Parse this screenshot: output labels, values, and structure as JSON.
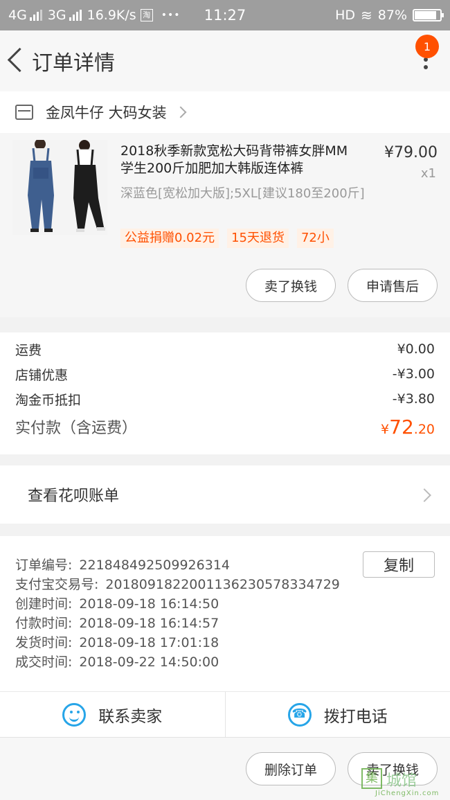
{
  "status_bar": {
    "net1": "4G",
    "net2": "3G",
    "speed": "16.9K/s",
    "app_icon_text": "淘",
    "dots": "•••",
    "time": "11:27",
    "hd": "HD",
    "wifi_glyph": "≋",
    "battery": "87%",
    "battery_level": 0.87
  },
  "navbar": {
    "title": "订单详情",
    "badge": "1"
  },
  "shop": {
    "name": "金凤牛仔 大码女装"
  },
  "product": {
    "title": "2018秋季新款宽松大码背带裤女胖MM学生200斤加肥加大韩版连体裤",
    "price": "¥79.00",
    "qty": "x1",
    "sku": "深蓝色[宽松加大版];5XL[建议180至200斤]",
    "tags": [
      "公益捐赠0.02元",
      "15天退货",
      "72小"
    ],
    "btn_sell": "卖了换钱",
    "btn_after_sale": "申请售后"
  },
  "fees": {
    "rows": [
      {
        "label": "运费",
        "value": "¥0.00"
      },
      {
        "label": "店铺优惠",
        "value": "-¥3.00"
      },
      {
        "label": "淘金币抵扣",
        "value": "-¥3.80"
      }
    ],
    "total_label": "实付款（含运费）",
    "total_currency": "¥",
    "total_int": "72",
    "total_dec": ".20"
  },
  "huabei": {
    "label": "查看花呗账单"
  },
  "order_info": {
    "copy_label": "复制",
    "rows": [
      {
        "k": "订单编号:",
        "v": "221848492509926314"
      },
      {
        "k": "支付宝交易号:",
        "v": "2018091822001136230578334729"
      },
      {
        "k": "创建时间:",
        "v": "2018-09-18 16:14:50"
      },
      {
        "k": "付款时间:",
        "v": "2018-09-18 16:14:57"
      },
      {
        "k": "发货时间:",
        "v": "2018-09-18 17:01:18"
      },
      {
        "k": "成交时间:",
        "v": "2018-09-22 14:50:00"
      }
    ]
  },
  "contact": {
    "seller": "联系卖家",
    "call": "拨打电话"
  },
  "bottom": {
    "delete_order": "删除订单",
    "sell": "卖了换钱"
  },
  "watermark": {
    "box": "集",
    "text": "城馆",
    "url": "JiChengXin.com"
  },
  "colors": {
    "accent": "#ff5000",
    "icon_blue": "#27a5e8"
  }
}
